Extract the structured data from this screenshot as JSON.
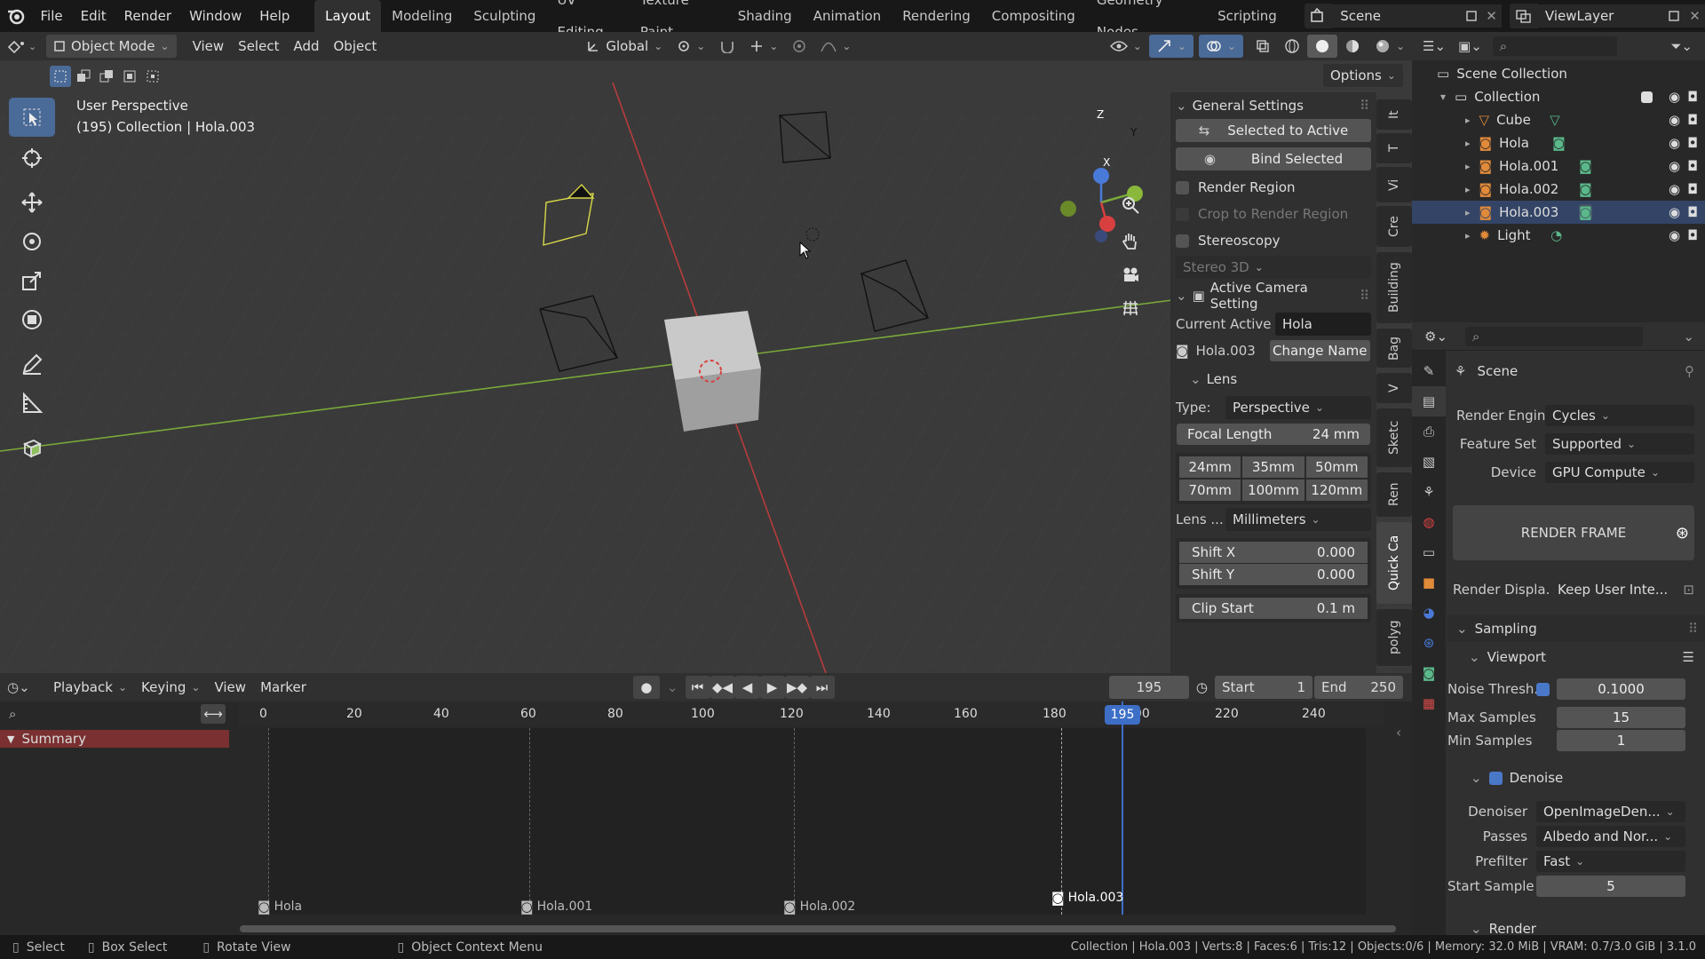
{
  "topbar": {
    "menus": [
      "File",
      "Edit",
      "Render",
      "Window",
      "Help"
    ],
    "workspaces": [
      "Layout",
      "Modeling",
      "Sculpting",
      "UV Editing",
      "Texture Paint",
      "Shading",
      "Animation",
      "Rendering",
      "Compositing",
      "Geometry Nodes",
      "Scripting"
    ],
    "active_workspace": "Layout",
    "scene": "Scene",
    "view_layer": "ViewLayer"
  },
  "viewport_header": {
    "mode": "Object Mode",
    "menus": [
      "View",
      "Select",
      "Add",
      "Object"
    ],
    "orientation": "Global",
    "options": "Options"
  },
  "viewport": {
    "view_name": "User Perspective",
    "view_info": "(195) Collection | Hola.003"
  },
  "npanel": {
    "general_title": "General Settings",
    "selected_to_active": "Selected to Active",
    "bind_selected": "Bind Selected",
    "render_region": "Render Region",
    "crop_region": "Crop to Render Region",
    "stereoscopy": "Stereoscopy",
    "stereo_mode": "Stereo 3D",
    "camera_title": "Active Camera Setting",
    "current_active_label": "Current Active",
    "current_active_value": "Hola",
    "camera_name": "Hola.003",
    "change_name": "Change Name",
    "lens_title": "Lens",
    "type_label": "Type:",
    "type_value": "Perspective",
    "focal_label": "Focal Length",
    "focal_value": "24 mm",
    "presets": [
      "24mm",
      "35mm",
      "50mm",
      "70mm",
      "100mm",
      "120mm"
    ],
    "lens_unit_label": "Lens ...",
    "lens_unit_value": "Millimeters",
    "shift_x_label": "Shift X",
    "shift_x_value": "0.000",
    "shift_y_label": "Shift Y",
    "shift_y_value": "0.000",
    "clip_start_label": "Clip Start",
    "clip_start_value": "0.1 m",
    "tabs": [
      "It",
      "T",
      "Vi",
      "Cre",
      "Building",
      "Bag",
      "V",
      "Sketc",
      "Ren",
      "Quick Ca",
      "polyg"
    ]
  },
  "outliner": {
    "root": "Scene Collection",
    "collection": "Collection",
    "items": [
      "Cube",
      "Hola",
      "Hola.001",
      "Hola.002",
      "Hola.003",
      "Light"
    ]
  },
  "properties": {
    "scene": "Scene",
    "render_engine_label": "Render Engine",
    "render_engine": "Cycles",
    "feature_set_label": "Feature Set",
    "feature_set": "Supported",
    "device_label": "Device",
    "device": "GPU Compute",
    "render_frame": "RENDER FRAME",
    "render_display_label": "Render Displa...",
    "render_display": "Keep User Inte...",
    "sampling": "Sampling",
    "viewport": "Viewport",
    "noise_label": "Noise Thresh...",
    "noise_value": "0.1000",
    "max_samples_label": "Max Samples",
    "max_samples": "15",
    "min_samples_label": "Min Samples",
    "min_samples": "1",
    "denoise": "Denoise",
    "denoiser_label": "Denoiser",
    "denoiser": "OpenImageDen...",
    "passes_label": "Passes",
    "passes": "Albedo and Nor...",
    "prefilter_label": "Prefilter",
    "prefilter": "Fast",
    "start_sample_label": "Start Sample",
    "start_sample": "5",
    "render": "Render"
  },
  "timeline": {
    "menus": [
      "Playback",
      "Keying",
      "View",
      "Marker"
    ],
    "current_frame": "195",
    "start_label": "Start",
    "start": "1",
    "end_label": "End",
    "end": "250",
    "ticks": [
      "0",
      "20",
      "40",
      "60",
      "80",
      "100",
      "120",
      "140",
      "160",
      "180",
      "200",
      "220",
      "240"
    ],
    "playhead_label": "195",
    "summary": "Summary",
    "markers": [
      "Hola",
      "Hola.001",
      "Hola.002",
      "Hola.003"
    ]
  },
  "statusbar": {
    "select": "Select",
    "box_select": "Box Select",
    "rotate_view": "Rotate View",
    "context_menu": "Object Context Menu",
    "stats": "Collection | Hola.003 | Verts:8 | Faces:6 | Tris:12 | Objects:0/6 | Memory: 32.0 MiB | VRAM: 0.7/3.0 GiB | 3.1.0"
  },
  "colors": {
    "accent": "#4a78c8",
    "summary_bg": "#7a3030",
    "playhead": "#3d6fc7",
    "x_axis": "#b83c3c",
    "y_axis": "#7aa83a"
  }
}
